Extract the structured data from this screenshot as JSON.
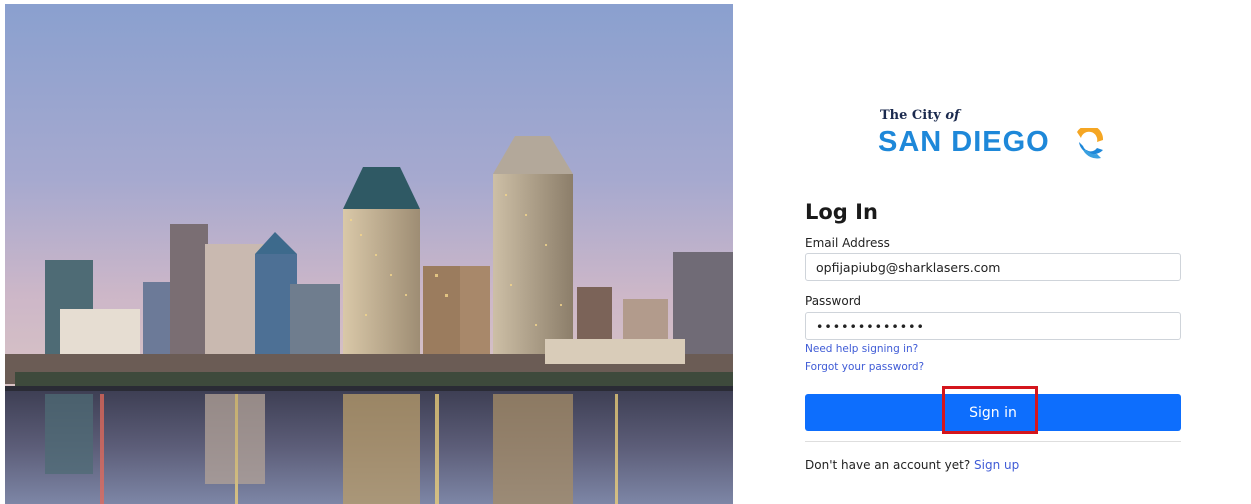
{
  "hero": {
    "image": "san-diego-skyline-photo"
  },
  "logo": {
    "top_text": "The City",
    "top_text_italic": "of",
    "main_text": "SAN DIEGO",
    "colors": {
      "text_dark": "#1b2a4e",
      "text_blue": "#1e88d9",
      "sun_orange": "#f5a623",
      "sun_blue": "#1e88d9"
    }
  },
  "form": {
    "title": "Log In",
    "email_label": "Email Address",
    "email_value": "opfijapiubg@sharklasers.com",
    "password_label": "Password",
    "password_value": "•••••••••••••",
    "help_link": "Need help signing in?",
    "forgot_link": "Forgot your password?",
    "signin_label": "Sign in",
    "signup_prompt": "Don't have an account yet?",
    "signup_link": "Sign up"
  },
  "colors": {
    "primary_button": "#0d6efd",
    "link": "#3f5bd6",
    "highlight_box": "#d4161d"
  }
}
